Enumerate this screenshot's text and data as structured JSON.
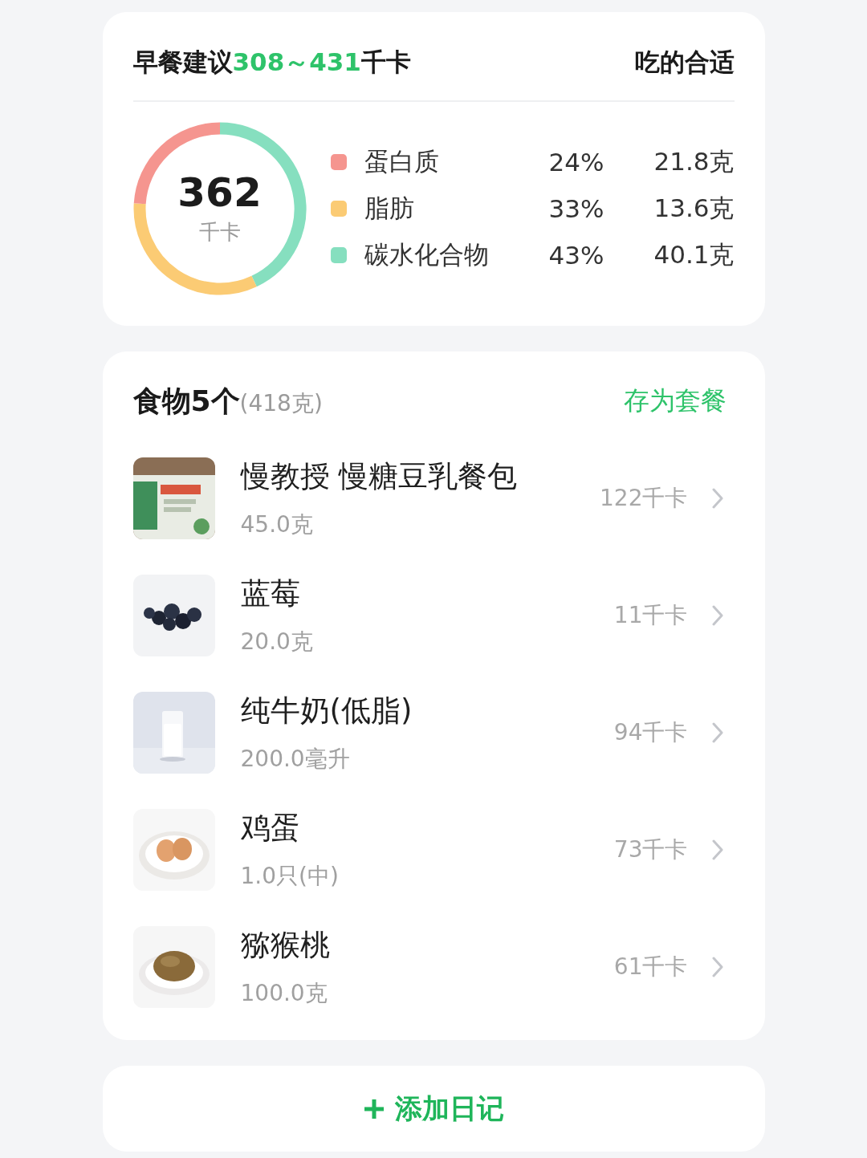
{
  "meal": {
    "title_prefix": "早餐建议",
    "range": "308～431",
    "unit": "千卡",
    "verdict": "吃的合适"
  },
  "summary": {
    "calories": "362",
    "calories_unit": "千卡",
    "nutrients": [
      {
        "name": "蛋白质",
        "percent": "24%",
        "amount": "21.8克",
        "color": "#f5958f"
      },
      {
        "name": "脂肪",
        "percent": "33%",
        "amount": "13.6克",
        "color": "#fbcb74"
      },
      {
        "name": "碳水化合物",
        "percent": "43%",
        "amount": "40.1克",
        "color": "#86dfbf"
      }
    ]
  },
  "foods": {
    "title": "食物5个",
    "weight": "(418克)",
    "action": "存为套餐",
    "items": [
      {
        "name": "慢教授 慢糖豆乳餐包",
        "amount": "45.0克",
        "calories": "122千卡",
        "kind": "picture"
      },
      {
        "name": "蓝莓",
        "amount": "20.0克",
        "calories": "11千卡",
        "kind": "picture"
      },
      {
        "name": "纯牛奶(低脂)",
        "amount": "200.0毫升",
        "calories": "94千卡",
        "kind": "picture"
      },
      {
        "name": "鸡蛋",
        "amount": "1.0只(中)",
        "calories": "73千卡",
        "kind": "picture"
      },
      {
        "name": "猕猴桃",
        "amount": "100.0克",
        "calories": "61千卡",
        "kind": "picture"
      }
    ]
  },
  "add_button": {
    "label": "添加日记"
  }
}
